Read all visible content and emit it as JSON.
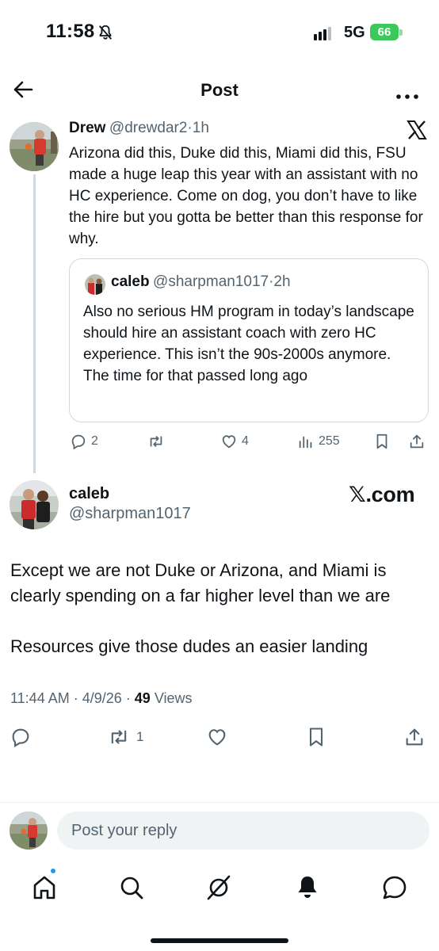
{
  "status_bar": {
    "time": "11:58",
    "network": "5G",
    "battery": "66"
  },
  "header": {
    "title": "Post"
  },
  "post_parent": {
    "name": "Drew",
    "handle": "@drewdar2",
    "time": "1h",
    "text": "Arizona did this, Duke did this, Miami did this, FSU made a huge leap this year with an assistant with no HC experience. Come on dog, you don’t have to like the hire but you gotta be better than this response for why.",
    "quote": {
      "name": "caleb",
      "handle": "@sharpman1017",
      "time": "2h",
      "text": "Also no serious HM program in today’s landscape should hire an assistant coach with zero HC experience. This isn’t the 90s-2000s anymore. The time for that passed long ago"
    },
    "stats": {
      "replies": "2",
      "likes": "4",
      "views": "255"
    }
  },
  "post_main": {
    "name": "caleb",
    "handle": "@sharpman1017",
    "watermark": "𝕏.com",
    "text_1": "Except we are not Duke or Arizona, and Miami is clearly spending on a far higher level than we are",
    "text_2": "Resources give those dudes an easier landing",
    "time": "11:44 AM",
    "date": "4/9/26",
    "views_count": "49",
    "views_label": "Views",
    "reposts": "1"
  },
  "reply": {
    "placeholder": "Post your reply"
  },
  "icons": {
    "back": "arrow-left-icon",
    "more": "more-horizontal-icon",
    "x_logo": "x-logo-icon",
    "nav": [
      "home-icon",
      "search-icon",
      "grok-icon",
      "notifications-icon",
      "messages-icon"
    ]
  },
  "colors": {
    "accent": "#1d9bf0",
    "text": "#0f1419",
    "muted": "#536471",
    "border": "#cfd9de"
  }
}
